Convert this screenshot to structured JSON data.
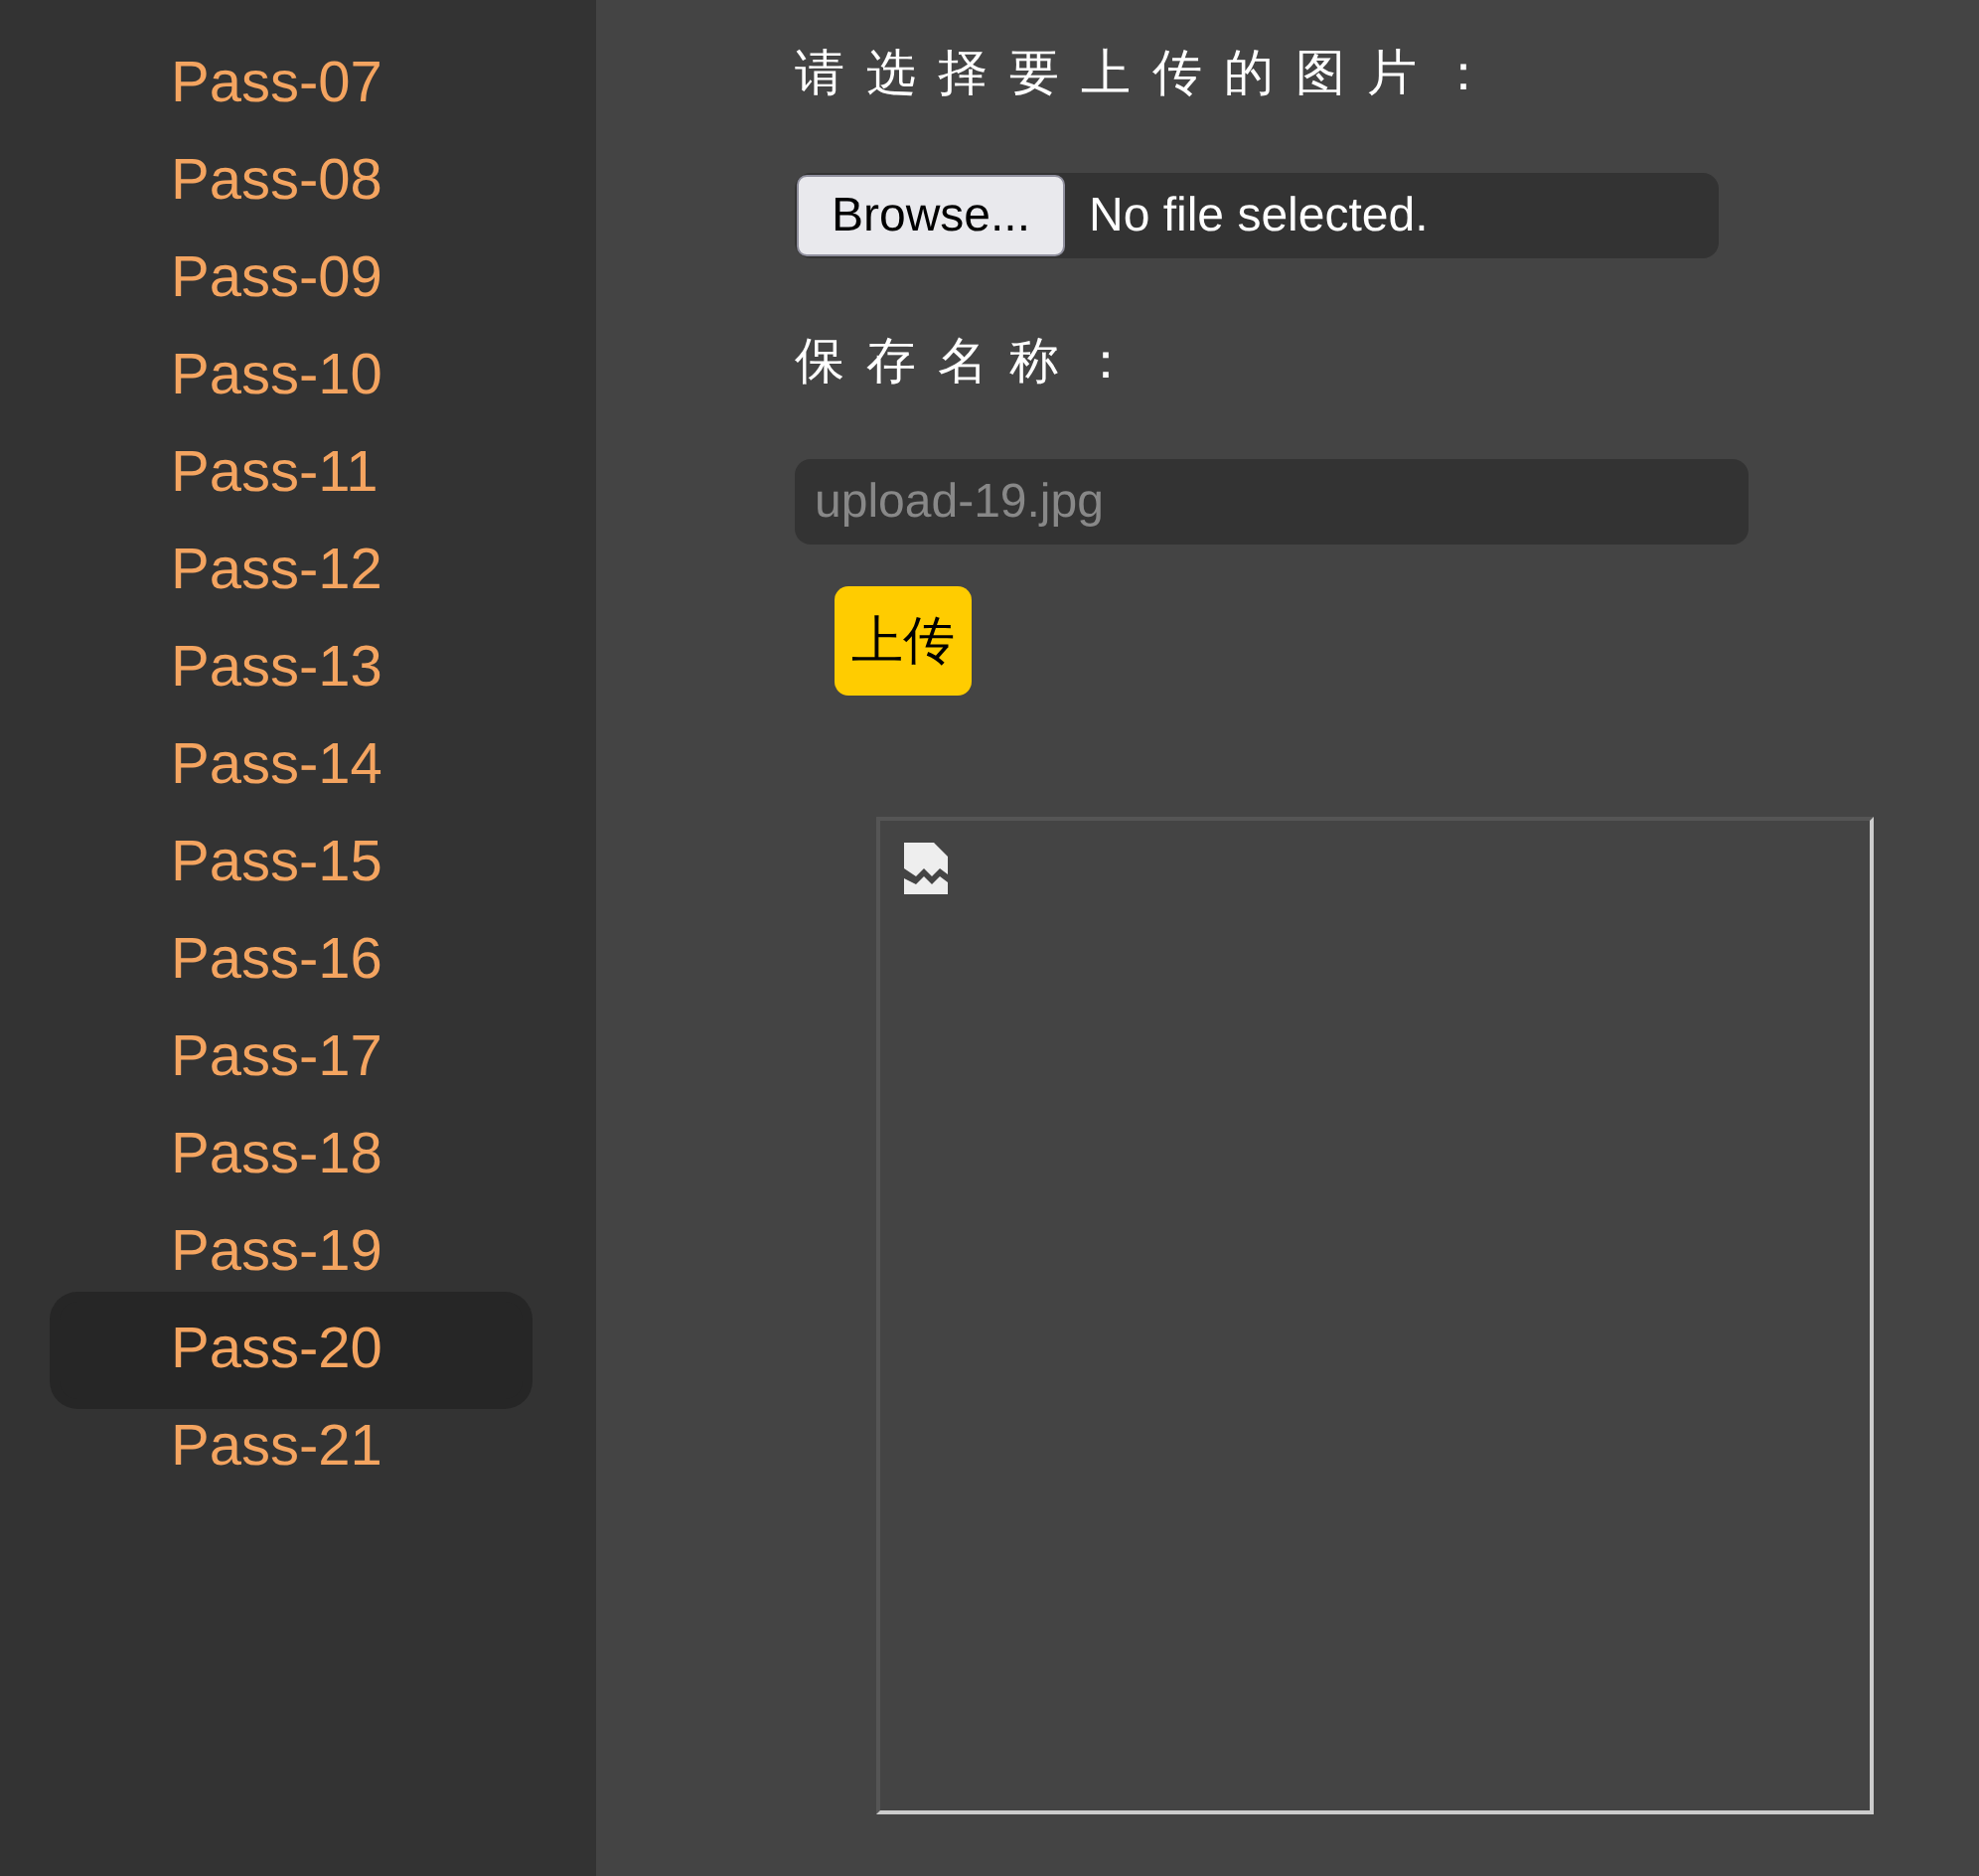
{
  "sidebar": {
    "items": [
      {
        "label": "Pass-07",
        "selected": false
      },
      {
        "label": "Pass-08",
        "selected": false
      },
      {
        "label": "Pass-09",
        "selected": false
      },
      {
        "label": "Pass-10",
        "selected": false
      },
      {
        "label": "Pass-11",
        "selected": false
      },
      {
        "label": "Pass-12",
        "selected": false
      },
      {
        "label": "Pass-13",
        "selected": false
      },
      {
        "label": "Pass-14",
        "selected": false
      },
      {
        "label": "Pass-15",
        "selected": false
      },
      {
        "label": "Pass-16",
        "selected": false
      },
      {
        "label": "Pass-17",
        "selected": false
      },
      {
        "label": "Pass-18",
        "selected": false
      },
      {
        "label": "Pass-19",
        "selected": false
      },
      {
        "label": "Pass-20",
        "selected": true
      },
      {
        "label": "Pass-21",
        "selected": false
      }
    ]
  },
  "form": {
    "file_label": "请选择要上传的图片：",
    "file_input": {
      "button": "Browse...",
      "status": "No file selected."
    },
    "name_label": "保存名称：",
    "name_input": {
      "placeholder": "upload-19.jpg"
    },
    "submit": "上传",
    "preview": {
      "kind": "broken-image"
    }
  }
}
